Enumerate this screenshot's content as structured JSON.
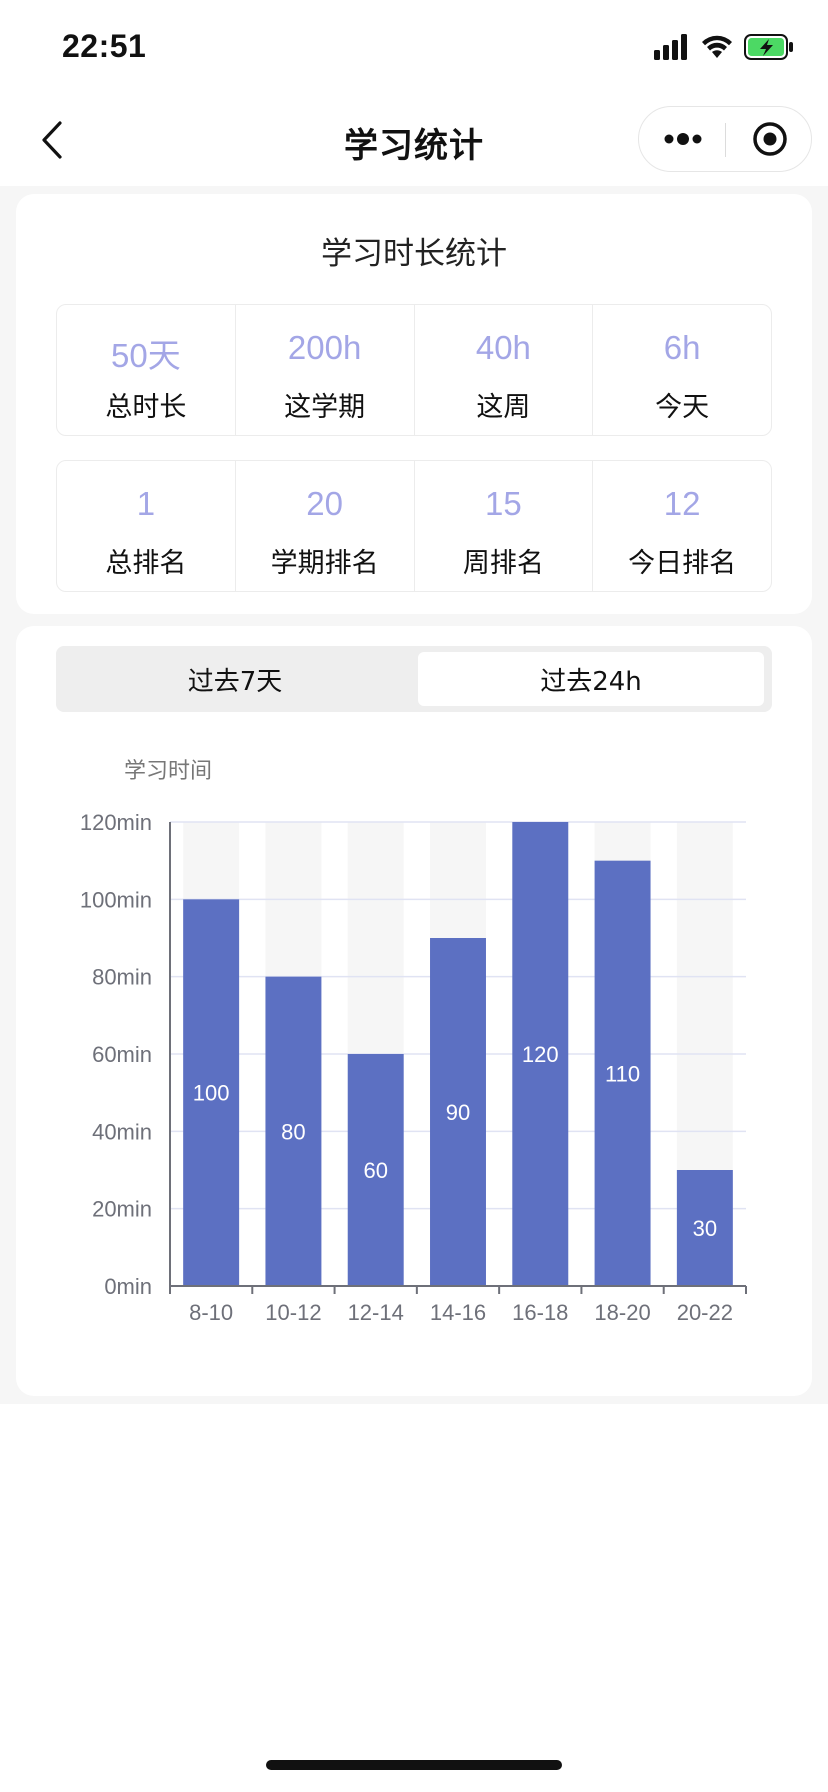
{
  "status_bar": {
    "time": "22:51",
    "icons": [
      "signal-icon",
      "wifi-icon",
      "battery-charging-icon"
    ],
    "battery_color": "#4cd964"
  },
  "nav": {
    "title": "学习统计",
    "back_icon": "chevron-left-icon",
    "more_icon": "more-dots-icon",
    "close_icon": "target-close-icon"
  },
  "summary": {
    "title": "学习时长统计",
    "accent_color": "#a3a6e6",
    "duration": [
      {
        "value": "50天",
        "label": "总时长"
      },
      {
        "value": "200h",
        "label": "这学期"
      },
      {
        "value": "40h",
        "label": "这周"
      },
      {
        "value": "6h",
        "label": "今天"
      }
    ],
    "ranking": [
      {
        "value": "1",
        "label": "总排名"
      },
      {
        "value": "20",
        "label": "学期排名"
      },
      {
        "value": "15",
        "label": "周排名"
      },
      {
        "value": "12",
        "label": "今日排名"
      }
    ]
  },
  "tabs": [
    {
      "label": "过去7天",
      "active": false
    },
    {
      "label": "过去24h",
      "active": true
    }
  ],
  "chart_data": {
    "type": "bar",
    "ylabel": "学习时间",
    "categories": [
      "8-10",
      "10-12",
      "12-14",
      "14-16",
      "16-18",
      "18-20",
      "20-22"
    ],
    "values": [
      100,
      80,
      60,
      90,
      120,
      110,
      30
    ],
    "ylim": [
      0,
      120
    ],
    "yticks": [
      0,
      20,
      40,
      60,
      80,
      100,
      120
    ],
    "ytick_suffix": "min",
    "grid": true,
    "background_bars": true,
    "bar_color": "#5c70c2",
    "background_bar_color": "#f6f6f6",
    "grid_color": "#e0e3f3"
  }
}
